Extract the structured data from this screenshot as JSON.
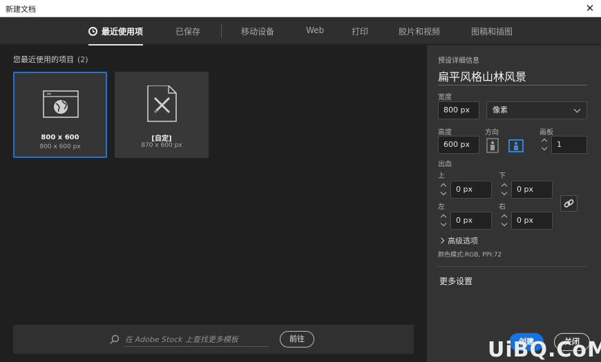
{
  "window": {
    "title": "新建文档",
    "close_glyph": "✕"
  },
  "tabs": [
    {
      "label": "最近使用项",
      "active": true,
      "icon": "clock-icon"
    },
    {
      "label": "已保存"
    },
    {
      "label": "移动设备"
    },
    {
      "label": "Web"
    },
    {
      "label": "打印"
    },
    {
      "label": "胶片和视频"
    },
    {
      "label": "图稿和插图"
    }
  ],
  "recent": {
    "title": "您最近使用的项目",
    "count": "(2)",
    "items": [
      {
        "name": "800 x 600",
        "sub": "800 x 600 px",
        "icon": "web-globe-icon",
        "selected": true
      },
      {
        "name": "[自定]",
        "sub": "870 x 600 px",
        "icon": "custom-document-icon",
        "selected": false
      }
    ]
  },
  "search": {
    "placeholder": "在 Adobe Stock 上查找更多模板",
    "go_label": "前往"
  },
  "preset": {
    "header": "预设详细信息",
    "name": "扁平风格山林风景",
    "width_label": "宽度",
    "width_value": "800 px",
    "unit": "像素",
    "height_label": "高度",
    "height_value": "600 px",
    "orientation_label": "方向",
    "artboard_label": "画板",
    "artboard_value": "1",
    "bleed_label": "出血",
    "bleed_top_label": "上",
    "bleed_top": "0 px",
    "bleed_bottom_label": "下",
    "bleed_bottom": "0 px",
    "bleed_left_label": "左",
    "bleed_left": "0 px",
    "bleed_right_label": "右",
    "bleed_right": "0 px",
    "advanced_label": "高级选项",
    "color_mode": "颜色模式:RGB, PPI:72",
    "more_settings": "更多设置"
  },
  "actions": {
    "create": "创建",
    "close": "关闭"
  },
  "watermark": "UiBQ.CoM",
  "colors": {
    "accent": "#1473e6",
    "selection": "#1e73d8",
    "panel": "#333333",
    "main": "#1f1f1f"
  }
}
